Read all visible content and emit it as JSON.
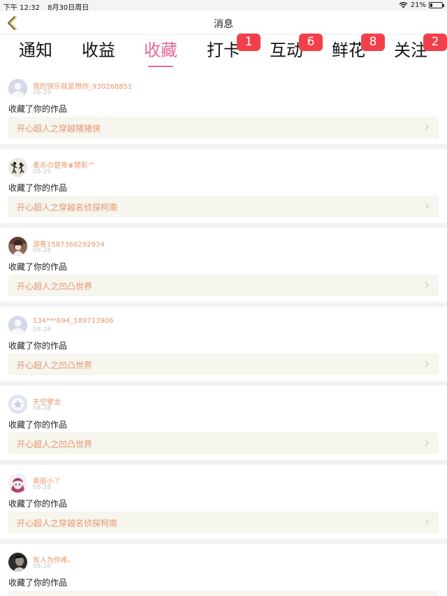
{
  "status_bar": {
    "time": "下午 12:32",
    "date": "8月30日周日",
    "battery": "21%",
    "battery_level": 0.21
  },
  "nav": {
    "title": "消息"
  },
  "tabs": [
    {
      "label": "通知",
      "badge": ""
    },
    {
      "label": "收益",
      "badge": ""
    },
    {
      "label": "收藏",
      "badge": "",
      "active": true
    },
    {
      "label": "打卡",
      "badge": "1"
    },
    {
      "label": "互动",
      "badge": "6"
    },
    {
      "label": "鲜花",
      "badge": "8"
    },
    {
      "label": "关注",
      "badge": "2"
    }
  ],
  "items": [
    {
      "user": "我的快乐就是想你_930268851",
      "date": "08-29",
      "action": "收藏了你的作品",
      "work": "开心超人之穿越猪猪侠",
      "avatar": "default"
    },
    {
      "user": "柔杀の楚帝♛閒影™",
      "date": "08-29",
      "action": "收藏了你的作品",
      "work": "开心超人之穿越名侦探柯南",
      "avatar": "photo-dancers"
    },
    {
      "user": "游客1587366292934",
      "date": "08-28",
      "action": "收藏了你的作品",
      "work": "开心超人之凹凸世界",
      "avatar": "photo-girl"
    },
    {
      "user": "134***694_189713906",
      "date": "08-28",
      "action": "收藏了你的作品",
      "work": "开心超人之凹凸世界",
      "avatar": "default"
    },
    {
      "user": "天空擎龙",
      "date": "08-28",
      "action": "收藏了你的作品",
      "work": "开心超人之凹凸世界",
      "avatar": "star"
    },
    {
      "user": "美丽小丫",
      "date": "08-28",
      "action": "收藏了你的作品",
      "work": "开心超人之穿越名侦探柯南",
      "avatar": "anime"
    },
    {
      "user": "有人为你疼。",
      "date": "08-28",
      "action": "收藏了你的作品",
      "work": "",
      "avatar": "photo-dark"
    }
  ],
  "colors": {
    "accent": "#e3679d",
    "badge": "#f2404b",
    "username": "#e8956c",
    "link_bg": "#f6f5ee"
  },
  "icons": {
    "back": "chevron-left-icon",
    "wifi": "wifi-icon",
    "battery": "battery-icon",
    "chevron": "chevron-right-icon"
  }
}
